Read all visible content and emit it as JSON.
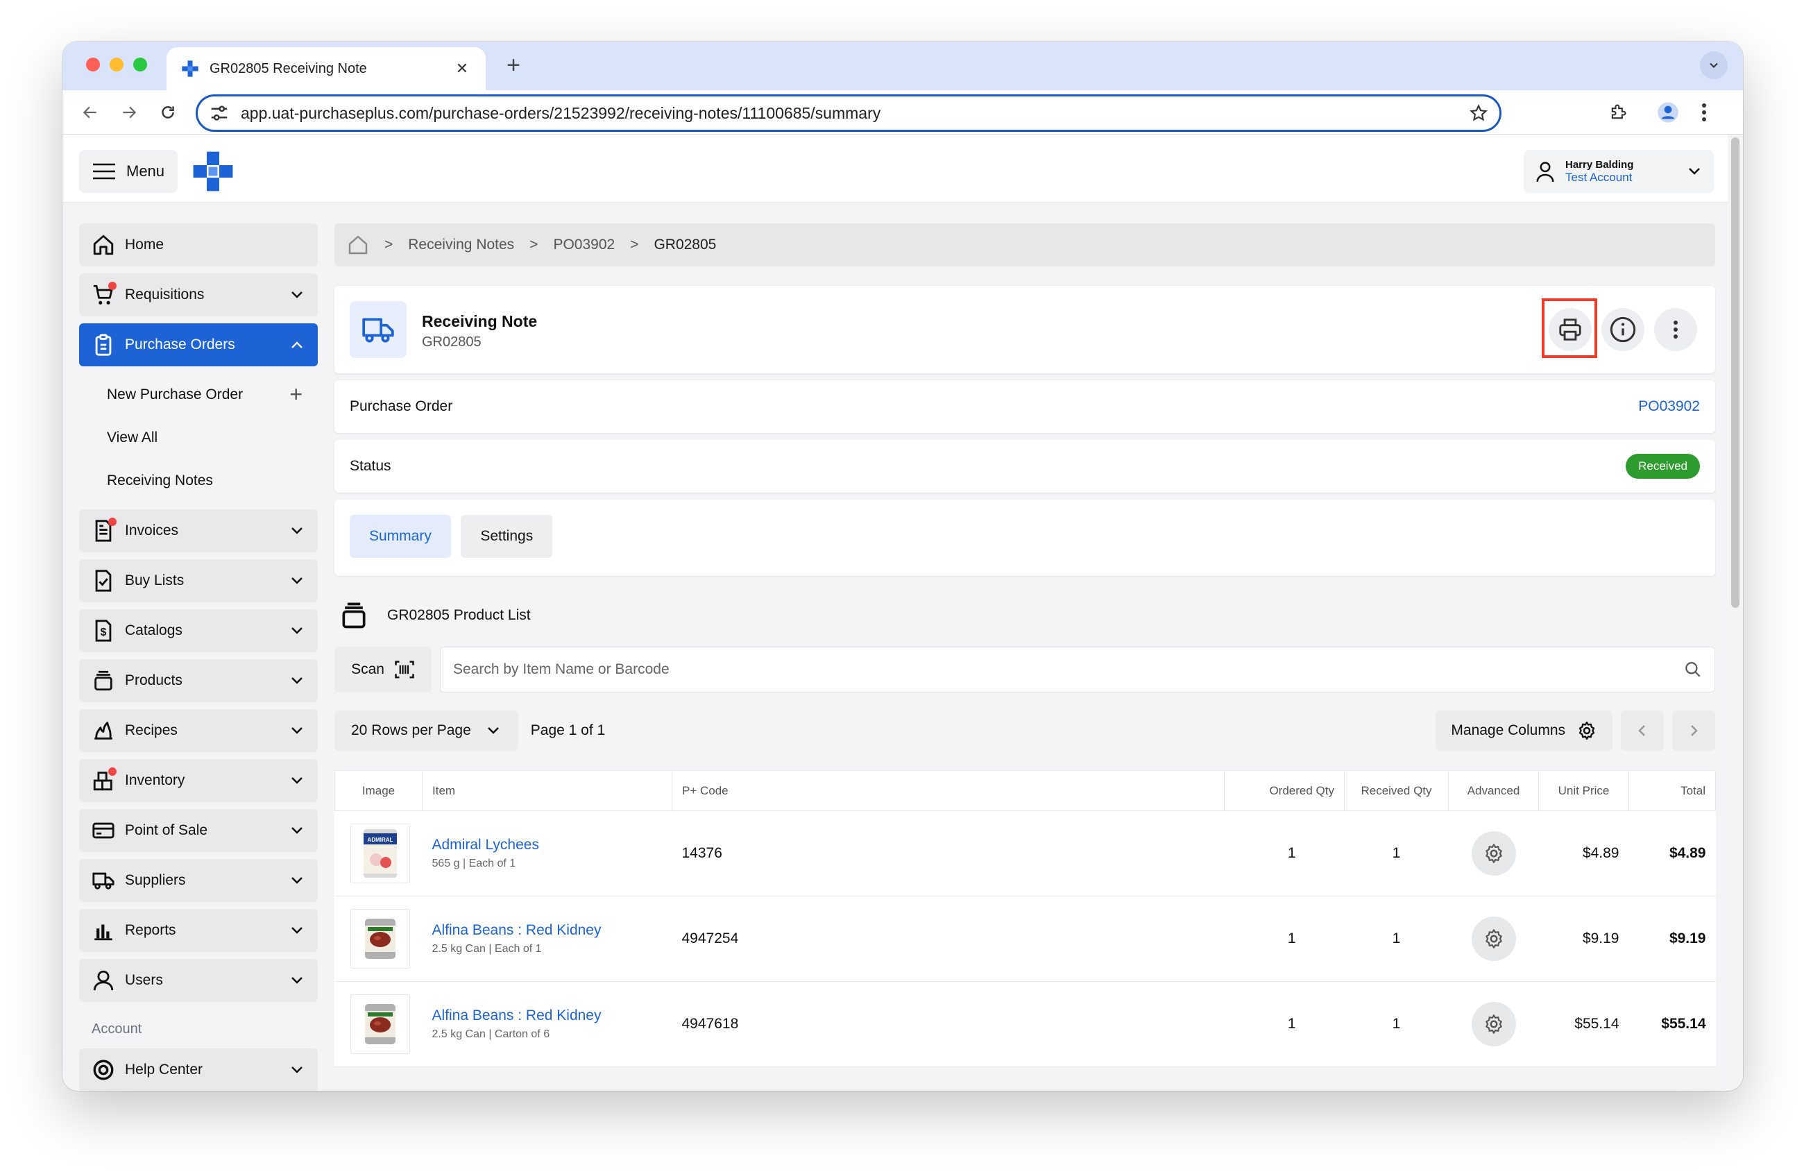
{
  "browser": {
    "tab_title": "GR02805 Receiving Note",
    "url": "app.uat-purchaseplus.com/purchase-orders/21523992/receiving-notes/11100685/summary"
  },
  "header": {
    "menu_label": "Menu",
    "user_name": "Harry Balding",
    "user_account": "Test Account"
  },
  "sidebar": {
    "items": [
      {
        "label": "Home",
        "icon": "home-icon"
      },
      {
        "label": "Requisitions",
        "icon": "cart-icon"
      },
      {
        "label": "Purchase Orders",
        "icon": "clipboard-icon"
      },
      {
        "label": "Invoices",
        "icon": "invoice-icon"
      },
      {
        "label": "Buy Lists",
        "icon": "checklist-icon"
      },
      {
        "label": "Catalogs",
        "icon": "dollar-doc-icon"
      },
      {
        "label": "Products",
        "icon": "box-stack-icon"
      },
      {
        "label": "Recipes",
        "icon": "flame-icon"
      },
      {
        "label": "Inventory",
        "icon": "boxes-icon"
      },
      {
        "label": "Point of Sale",
        "icon": "card-icon"
      },
      {
        "label": "Suppliers",
        "icon": "truck-icon"
      },
      {
        "label": "Reports",
        "icon": "bar-chart-icon"
      },
      {
        "label": "Users",
        "icon": "user-icon"
      }
    ],
    "sub_items": [
      "New Purchase Order",
      "View All",
      "Receiving Notes"
    ],
    "account_heading": "Account",
    "help_center": "Help Center"
  },
  "breadcrumb": [
    "Receiving Notes",
    "PO03902",
    "GR02805"
  ],
  "note": {
    "title": "Receiving Note",
    "number": "GR02805",
    "purchase_order_label": "Purchase Order",
    "purchase_order_value": "PO03902",
    "status_label": "Status",
    "status_value": "Received"
  },
  "tabs": [
    "Summary",
    "Settings"
  ],
  "product_list": {
    "title": "GR02805 Product List",
    "scan_label": "Scan",
    "search_placeholder": "Search by Item Name or Barcode",
    "rows_per_page": "20 Rows per Page",
    "page_info": "Page 1 of 1",
    "manage_columns": "Manage Columns"
  },
  "table": {
    "columns": [
      "Image",
      "Item",
      "P+ Code",
      "Ordered Qty",
      "Received Qty",
      "Advanced",
      "Unit Price",
      "Total"
    ],
    "rows": [
      {
        "name": "Admiral Lychees",
        "desc": "565 g | Each of 1",
        "code": "14376",
        "ordered": "1",
        "received": "1",
        "unit_price": "$4.89",
        "total": "$4.89"
      },
      {
        "name": "Alfina Beans : Red Kidney",
        "desc": "2.5 kg Can | Each of 1",
        "code": "4947254",
        "ordered": "1",
        "received": "1",
        "unit_price": "$9.19",
        "total": "$9.19"
      },
      {
        "name": "Alfina Beans : Red Kidney",
        "desc": "2.5 kg Can | Carton of 6",
        "code": "4947618",
        "ordered": "1",
        "received": "1",
        "unit_price": "$55.14",
        "total": "$55.14"
      }
    ]
  },
  "colors": {
    "accent": "#1d63d6",
    "status_green": "#2e9b2e",
    "highlight": "#ef3b2a"
  }
}
